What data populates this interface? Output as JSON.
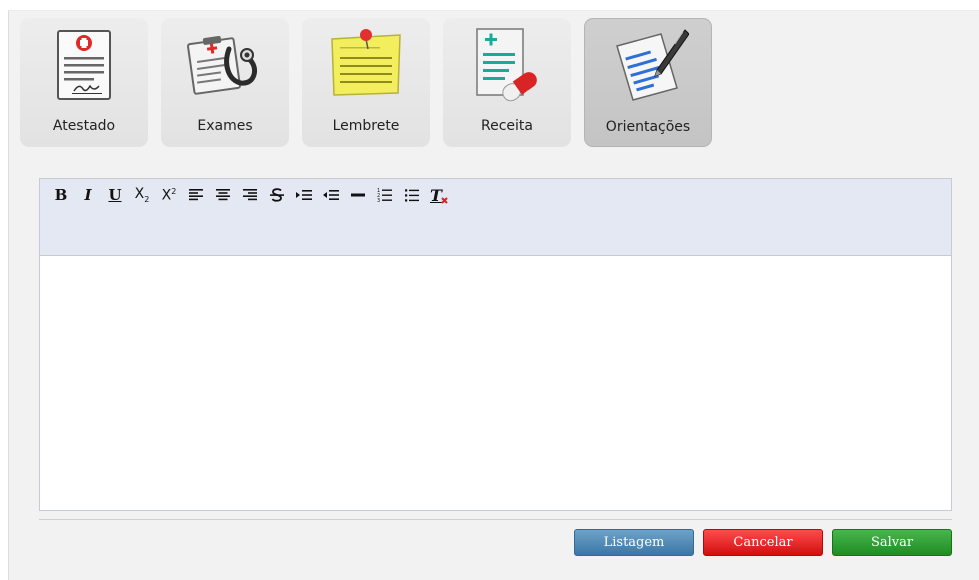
{
  "tabs": [
    {
      "label": "Atestado",
      "icon": "medical-certificate-icon"
    },
    {
      "label": "Exames",
      "icon": "stethoscope-clipboard-icon"
    },
    {
      "label": "Lembrete",
      "icon": "sticky-note-icon"
    },
    {
      "label": "Receita",
      "icon": "prescription-pill-icon"
    },
    {
      "label": "Orientações",
      "icon": "pen-document-icon",
      "active": true
    }
  ],
  "toolbar": {
    "bold": "B",
    "italic": "I",
    "underline": "U",
    "subscript_base": "X",
    "subscript_mark": "2",
    "superscript_base": "X",
    "superscript_mark": "2",
    "remove_format": "T"
  },
  "editor": {
    "content": ""
  },
  "buttons": {
    "list": "Listagem",
    "cancel": "Cancelar",
    "save": "Salvar"
  },
  "colors": {
    "toolbar_bg": "#e3e8f2",
    "list_button": "#4a86b4",
    "cancel_button": "#e81b1b",
    "save_button": "#2ea332",
    "active_tab": "#c9c9c9"
  }
}
